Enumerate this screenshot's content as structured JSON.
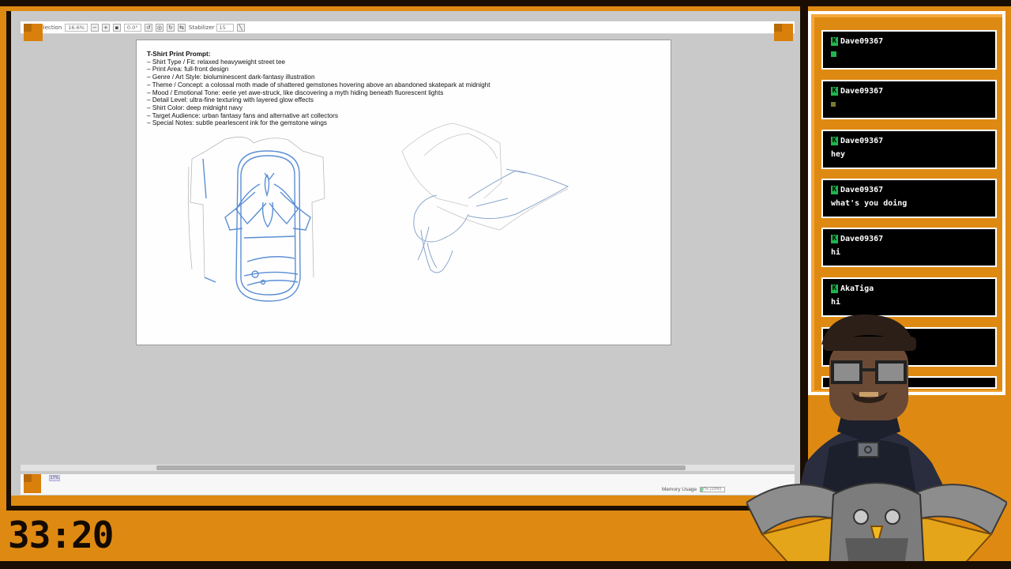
{
  "toolbar": {
    "selection_label": "Selection",
    "zoom": "16.6%",
    "angle": "0.0°",
    "stabilizer_label": "Stabilizer",
    "stabilizer_value": "15"
  },
  "prompt": {
    "title": "T-Shirt Print Prompt:",
    "lines": [
      "– Shirt Type / Fit: relaxed heavyweight street tee",
      "– Print Area: full-front design",
      "– Genre / Art Style: bioluminescent dark-fantasy illustration",
      "– Theme / Concept: a colossal moth made of shattered gemstones hovering above an abandoned skatepark at midnight",
      "– Mood / Emotional Tone: eerie yet awe-struck, like discovering a myth hiding beneath fluorescent lights",
      "– Detail Level: ultra-fine texturing with layered glow effects",
      "– Shirt Color: deep midnight navy",
      "– Target Audience: urban fantasy fans and alternative art collectors",
      "– Special Notes: subtle pearlescent ink for the gemstone wings"
    ]
  },
  "status": {
    "layer_opacity": "17%",
    "memory_label": "Memory Usage",
    "memory_value": "7% (10%)",
    "memory_fraction": 0.1
  },
  "timer": "33:20",
  "chat": {
    "accent": "#1fb54e",
    "messages": [
      {
        "user": "Dave09367",
        "text": ""
      },
      {
        "user": "Dave09367",
        "text": ""
      },
      {
        "user": "Dave09367",
        "text": "hey"
      },
      {
        "user": "Dave09367",
        "text": "what's you doing"
      },
      {
        "user": "Dave09367",
        "text": "hi"
      },
      {
        "user": "AkaTiga",
        "text": "hi"
      }
    ]
  },
  "colors": {
    "frame_orange": "#de8a12",
    "sketch_blue": "#5b8fd6",
    "chat_bg": "#000000"
  }
}
